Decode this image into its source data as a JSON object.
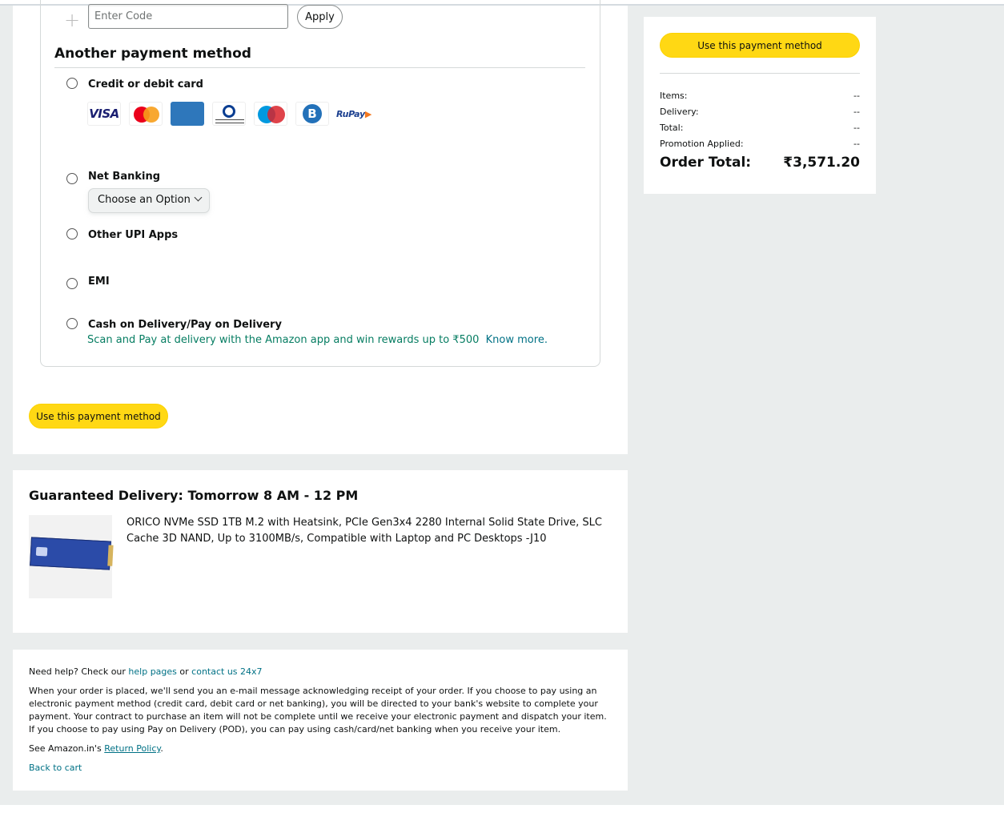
{
  "promo": {
    "placeholder": "Enter Code",
    "apply_label": "Apply"
  },
  "payment": {
    "section_title": "Another payment method",
    "options": [
      {
        "label": "Credit or debit card"
      },
      {
        "label": "Net Banking"
      },
      {
        "label": "Other UPI Apps"
      },
      {
        "label": "EMI"
      },
      {
        "label": "Cash on Delivery/Pay on Delivery"
      }
    ],
    "card_logos": [
      {
        "name": "visa",
        "text": "VISA",
        "color": "#1a1f71"
      },
      {
        "name": "mastercard",
        "text": "MasterCard",
        "color": "#eb001b"
      },
      {
        "name": "american-express",
        "text": "AMERICAN EXPRESS",
        "color": "#2e77bb"
      },
      {
        "name": "diners-club",
        "text": "Diners Club International",
        "color": "#0a3d91"
      },
      {
        "name": "maestro",
        "text": "Maestro",
        "color": "#0099df"
      },
      {
        "name": "bharat-pay",
        "text": "B",
        "color": "#2371b9"
      },
      {
        "name": "rupay",
        "text": "RuPay",
        "color": "#1b3f8f"
      }
    ],
    "netbanking_select": "Choose an Option",
    "cod_note": "Scan and Pay at delivery with the Amazon app and win rewards up to ₹500",
    "cod_link": "Know more.",
    "use_button": "Use this payment method"
  },
  "delivery": {
    "title": "Guaranteed Delivery: Tomorrow 8 AM - 12 PM",
    "product_title": "ORICO NVMe SSD 1TB M.2 with Heatsink, PCIe Gen3x4 2280 Internal Solid State Drive, SLC Cache 3D NAND, Up to 3100MB/s, Compatible with Laptop and PC Desktops -J10"
  },
  "footer": {
    "help_prefix": "Need help? Check our",
    "help_link": "help pages",
    "help_mid": "or",
    "contact_link": "contact us 24x7",
    "notice": "When your order is placed, we'll send you an e-mail message acknowledging receipt of your order. If you choose to pay using an electronic payment method (credit card, debit card or net banking), you will be directed to your bank's website to complete your payment. Your contract to purchase an item will not be complete until we receive your electronic payment and dispatch your item. If you choose to pay using Pay on Delivery (POD), you can pay using cash/card/net banking when you receive your item.",
    "return_prefix": "See Amazon.in's",
    "return_link": "Return Policy",
    "return_suffix": ".",
    "back_link": "Back to cart"
  },
  "summary": {
    "button": "Use this payment method",
    "rows": [
      {
        "label": "Items:",
        "value": "--"
      },
      {
        "label": "Delivery:",
        "value": "--"
      },
      {
        "label": "Total:",
        "value": "--"
      },
      {
        "label": "Promotion Applied:",
        "value": "--"
      }
    ],
    "order_total_label": "Order Total:",
    "order_total_value": "₹3,571.20"
  },
  "colors": {
    "accent_button": "#ffd814",
    "link": "#007185",
    "success": "#067d62",
    "background": "#eaeded"
  }
}
